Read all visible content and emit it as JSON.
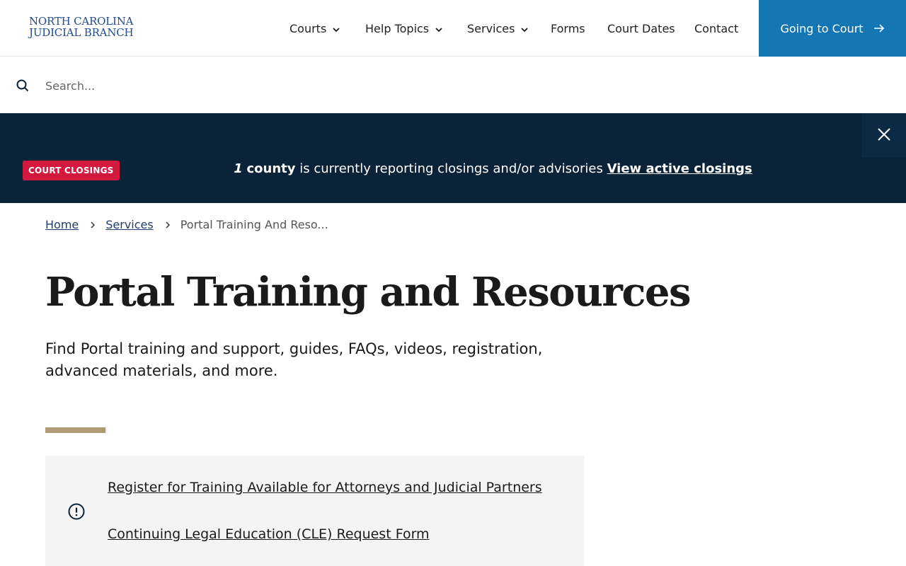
{
  "header": {
    "logo_line1": "NORTH CAROLINA",
    "logo_line2": "JUDICIAL BRANCH",
    "nav": [
      {
        "label": "Courts"
      },
      {
        "label": "Help Topics"
      },
      {
        "label": "Services"
      },
      {
        "label": "Forms"
      },
      {
        "label": "Court Dates"
      },
      {
        "label": "Contact"
      }
    ],
    "cta_label": "Going to Court"
  },
  "search": {
    "placeholder": "Search..."
  },
  "alert": {
    "badge": "COURT CLOSINGS",
    "count": "1",
    "count_label": "county",
    "message": "is currently reporting closings and/or advisories",
    "link": "View active closings"
  },
  "breadcrumb": {
    "home": "Home",
    "services": "Services",
    "current": "Portal Training And Reso..."
  },
  "page": {
    "title": "Portal Training and Resources",
    "intro": "Find Portal training and support, guides, FAQs, videos, registration, advanced materials, and more."
  },
  "panel": {
    "link1": "Register for Training Available for Attorneys and Judicial Partners",
    "link2": "Continuing Legal Education (CLE) Request Form"
  },
  "colors": {
    "brand_blue": "#1476b3",
    "alert_bg": "#0a2339",
    "badge_red": "#d4193f",
    "accent_tan": "#b09a74"
  }
}
